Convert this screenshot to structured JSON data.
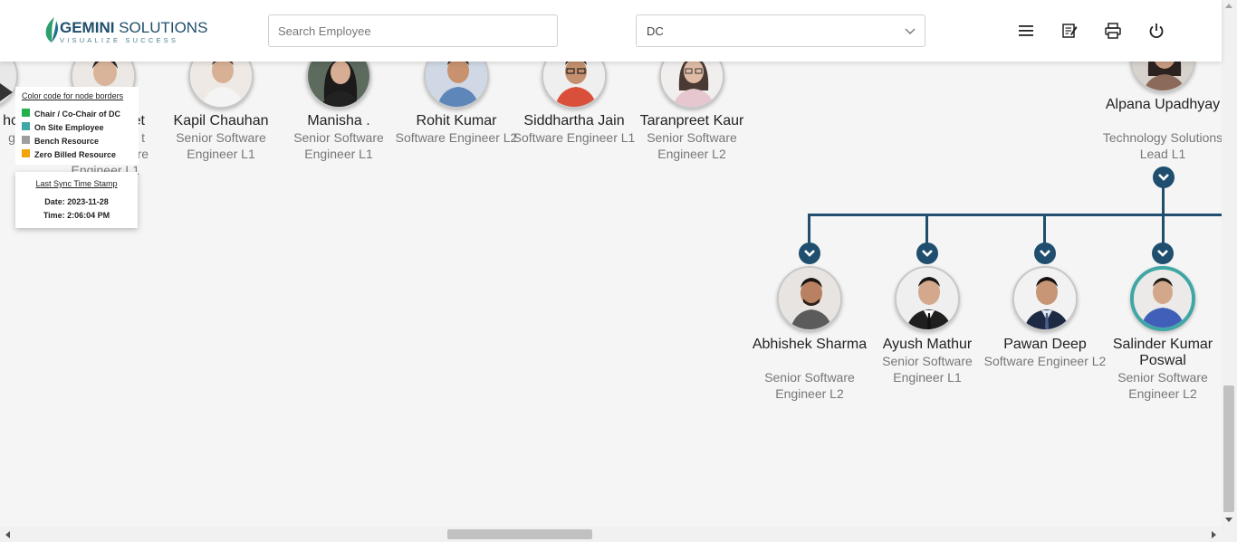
{
  "header": {
    "logo_name_bold": "GEMINI",
    "logo_name_rest": " SOLUTIONS",
    "logo_tagline": "VISUALIZE SUCCESS",
    "search_placeholder": "Search Employee",
    "search_value": "",
    "dropdown_value": "DC",
    "icons": [
      "menu-icon",
      "notes-icon",
      "print-icon",
      "power-icon"
    ]
  },
  "colors": {
    "connector": "#1f4e6e",
    "chair": "#22b14c",
    "on_site": "#3fa7a5",
    "bench": "#9e9e9e",
    "zero_billed": "#f0a30a"
  },
  "legend": {
    "title": "Color code for node borders",
    "items": [
      {
        "label": "Chair / Co-Chair of DC",
        "color": "#22b14c"
      },
      {
        "label": "On Site Employee",
        "color": "#3fa7a5"
      },
      {
        "label": "Bench Resource",
        "color": "#9e9e9e"
      },
      {
        "label": "Zero Billed Resource",
        "color": "#f0a30a"
      }
    ]
  },
  "sync": {
    "title": "Last Sync Time Stamp",
    "date": "Date: 2023-11-28",
    "time": "Time: 2:06:04 PM"
  },
  "partial": {
    "left_name": "hc",
    "left_title": "gi",
    "second_name": "et",
    "second_title_1": "t",
    "second_title_2": "re",
    "second_title_3": "Engineer L1"
  },
  "top_row": [
    {
      "name": "Kapil Chauhan",
      "title": "Senior Software Engineer L1"
    },
    {
      "name": "Manisha .",
      "title": "Senior Software Engineer L1"
    },
    {
      "name": "Rohit Kumar",
      "title": "Software Engineer L2"
    },
    {
      "name": "Siddhartha Jain",
      "title": "Software Engineer L1"
    },
    {
      "name": "Taranpreet Kaur",
      "title": "Senior Software Engineer L2"
    }
  ],
  "manager": {
    "name": "Alpana Upadhyay",
    "title": "Technology Solutions Lead L1"
  },
  "reports": [
    {
      "name": "Abhishek Sharma",
      "title": "Senior Software Engineer L2",
      "border": "default"
    },
    {
      "name": "Ayush Mathur",
      "title": "Senior Software Engineer L1",
      "border": "default"
    },
    {
      "name": "Pawan Deep",
      "title": "Software Engineer L2",
      "border": "default"
    },
    {
      "name": "Salinder Kumar Poswal",
      "title": "Senior Software Engineer L2",
      "border": "on_site"
    }
  ]
}
